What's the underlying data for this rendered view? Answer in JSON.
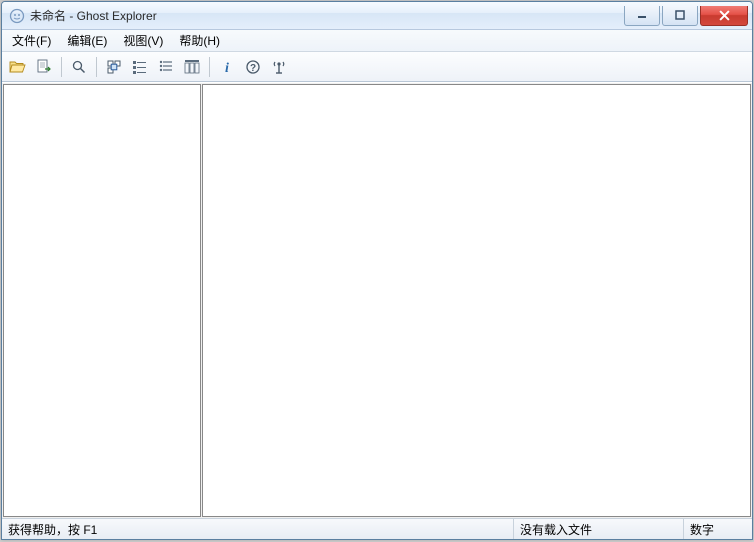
{
  "window": {
    "title": "未命名 - Ghost Explorer"
  },
  "menu": {
    "file": "文件(F)",
    "edit": "编辑(E)",
    "view": "视图(V)",
    "help": "帮助(H)"
  },
  "status": {
    "help_hint": "获得帮助，按 F1",
    "load_state": "没有载入文件",
    "num_indicator": "数字"
  }
}
